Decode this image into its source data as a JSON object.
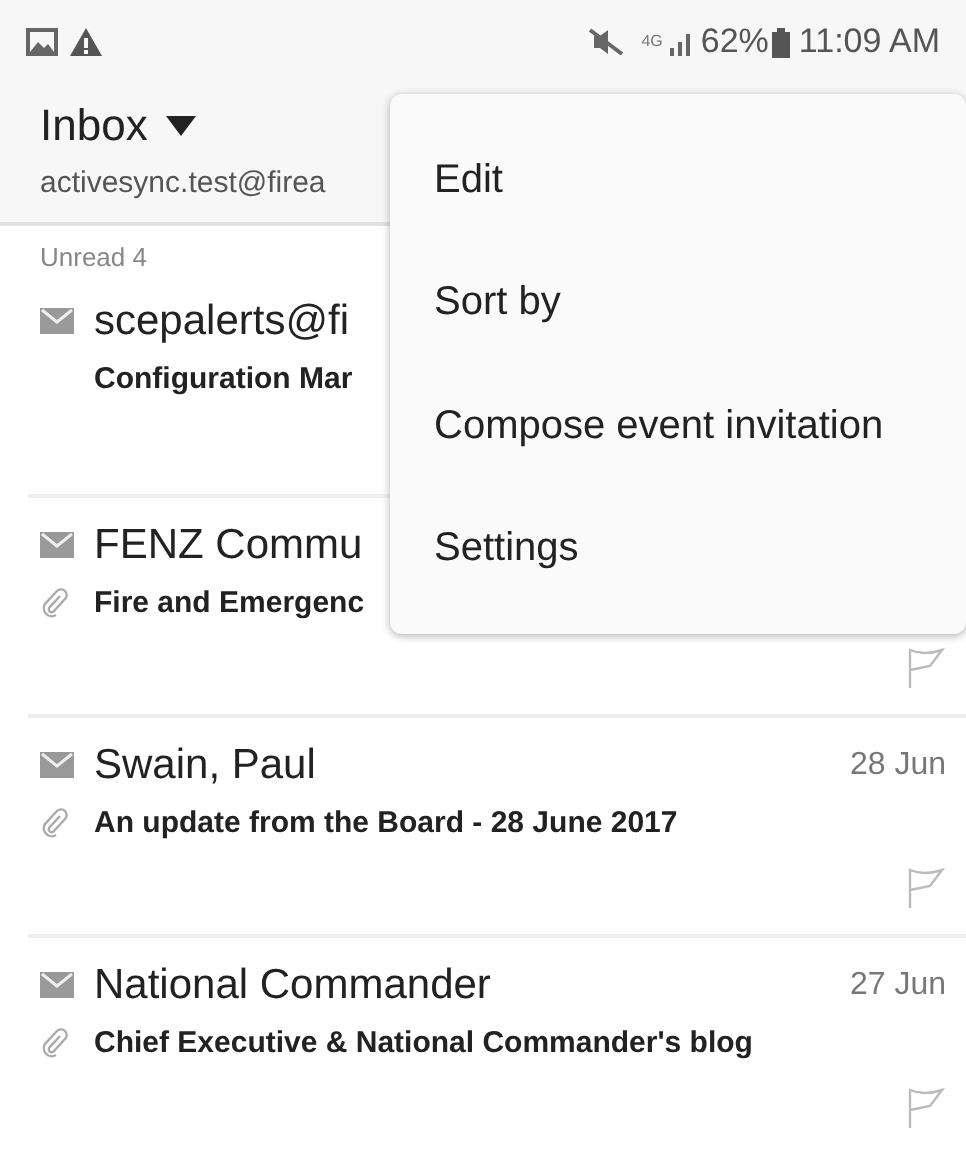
{
  "status_bar": {
    "network": "4G",
    "battery": "62%",
    "time": "11:09 AM"
  },
  "header": {
    "folder": "Inbox",
    "account": "activesync.test@firea"
  },
  "section": "Unread 4",
  "messages": [
    {
      "sender": "scepalerts@fi",
      "subject": "Configuration Mar",
      "attachment": false,
      "flag": false
    },
    {
      "sender": "FENZ Commu",
      "subject": "Fire and Emergenc",
      "attachment": true,
      "flag": true
    },
    {
      "sender": "Swain, Paul",
      "date": "28 Jun",
      "subject": "An update from the Board - 28 June 2017",
      "attachment": true,
      "flag": true
    },
    {
      "sender": "National Commander",
      "date": "27 Jun",
      "subject": "Chief Executive & National Commander's blog",
      "attachment": true,
      "flag": true
    }
  ],
  "menu": {
    "items": [
      "Edit",
      "Sort by",
      "Compose event invitation",
      "Settings"
    ]
  }
}
